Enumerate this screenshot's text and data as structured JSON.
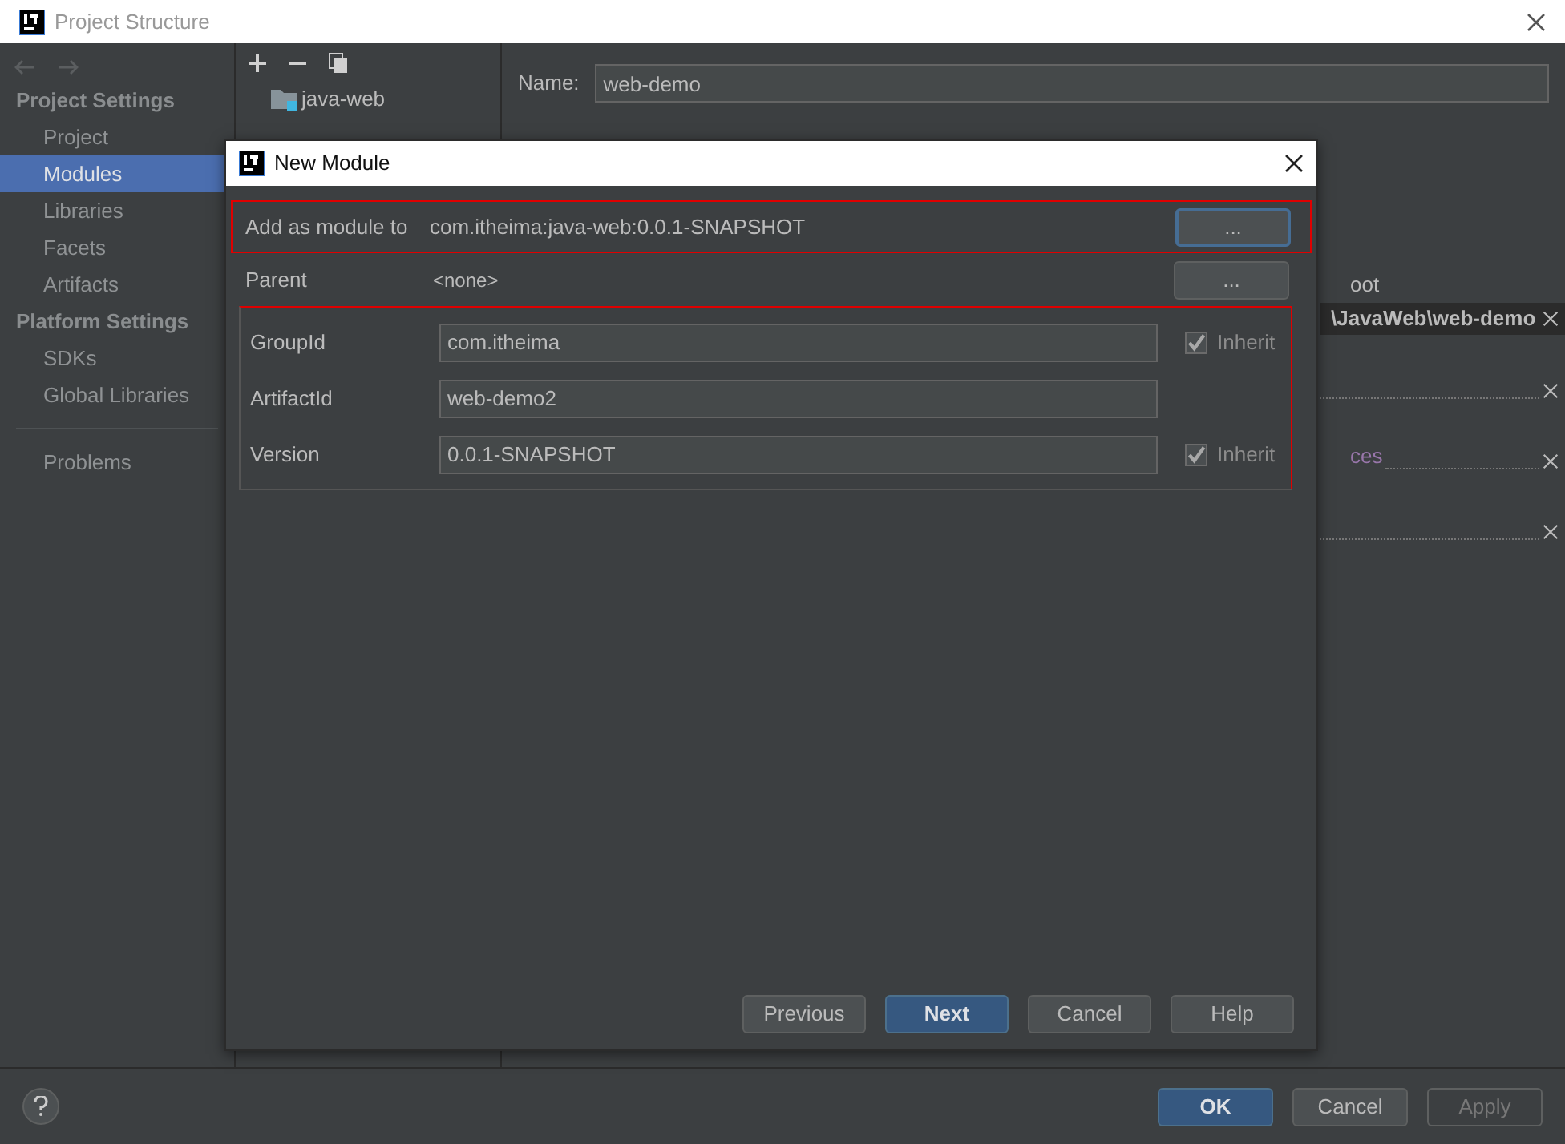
{
  "window": {
    "title": "Project Structure"
  },
  "sidebar": {
    "sections": [
      {
        "title": "Project Settings",
        "items": [
          {
            "label": "Project",
            "selected": false
          },
          {
            "label": "Modules",
            "selected": true
          },
          {
            "label": "Libraries",
            "selected": false
          },
          {
            "label": "Facets",
            "selected": false
          },
          {
            "label": "Artifacts",
            "selected": false
          }
        ]
      },
      {
        "title": "Platform Settings",
        "items": [
          {
            "label": "SDKs",
            "selected": false
          },
          {
            "label": "Global Libraries",
            "selected": false
          }
        ]
      }
    ],
    "extra_items": [
      {
        "label": "Problems",
        "selected": false
      }
    ]
  },
  "module_tree": {
    "items": [
      {
        "label": "java-web"
      }
    ]
  },
  "name_field": {
    "label": "Name:",
    "value": "web-demo"
  },
  "right_panel": {
    "root_label": "oot",
    "root_path": "\\JavaWeb\\web-demo",
    "folder_label": "ces"
  },
  "dialog": {
    "title": "New Module",
    "add_as_module_to": {
      "label": "Add as module to",
      "value": "com.itheima:java-web:0.0.1-SNAPSHOT",
      "button": "..."
    },
    "parent": {
      "label": "Parent",
      "value": "<none>",
      "button": "..."
    },
    "fields": [
      {
        "label": "GroupId",
        "value": "com.itheima",
        "inherit": {
          "label": "Inherit",
          "checked": true
        }
      },
      {
        "label": "ArtifactId",
        "value": "web-demo2"
      },
      {
        "label": "Version",
        "value": "0.0.1-SNAPSHOT",
        "inherit": {
          "label": "Inherit",
          "checked": true
        }
      }
    ],
    "buttons": [
      {
        "label": "Previous",
        "kind": "default"
      },
      {
        "label": "Next",
        "kind": "primary"
      },
      {
        "label": "Cancel",
        "kind": "default"
      },
      {
        "label": "Help",
        "kind": "default"
      }
    ]
  },
  "footer": {
    "buttons": [
      {
        "label": "OK",
        "kind": "primary"
      },
      {
        "label": "Cancel",
        "kind": "default"
      },
      {
        "label": "Apply",
        "kind": "disabled"
      }
    ]
  }
}
